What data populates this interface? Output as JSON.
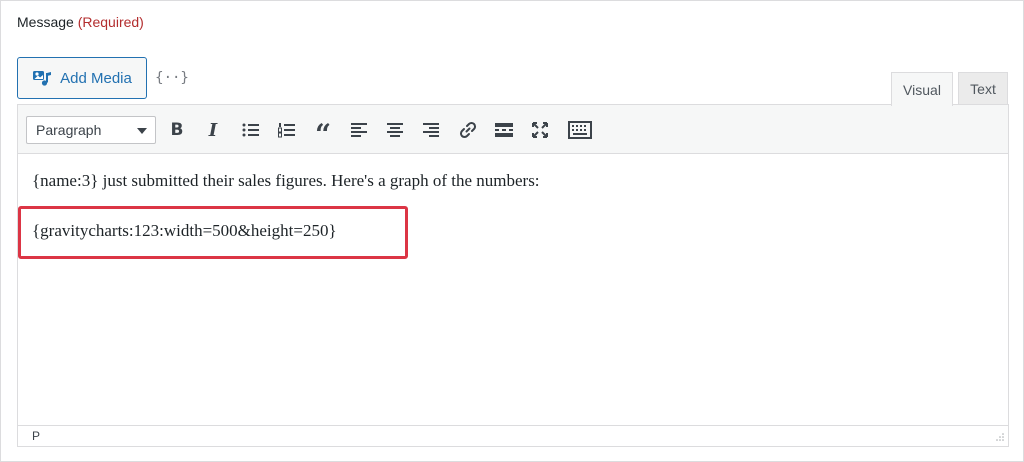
{
  "field": {
    "label": "Message",
    "required": "(Required)"
  },
  "media": {
    "add_label": "Add Media",
    "merge_tags_glyph": "{··}"
  },
  "tabs": [
    {
      "label": "Visual"
    },
    {
      "label": "Text"
    }
  ],
  "toolbar": {
    "format_selected": "Paragraph",
    "bold": "B",
    "italic": "I",
    "quote": "“",
    "buttons": [
      "bold",
      "italic",
      "bulleted-list",
      "numbered-list",
      "blockquote",
      "align-left",
      "align-center",
      "align-right",
      "insert-link",
      "read-more",
      "fullscreen",
      "toolbar-toggle"
    ]
  },
  "content": {
    "line1": "{name:3} just submitted their sales figures. Here's a graph of the numbers:",
    "line2": "{gravitycharts:123:width=500&height=250}"
  },
  "status": {
    "path": "P"
  },
  "colors": {
    "accent": "#2271b1",
    "required": "#b32d2e",
    "highlight": "#dc3545"
  }
}
